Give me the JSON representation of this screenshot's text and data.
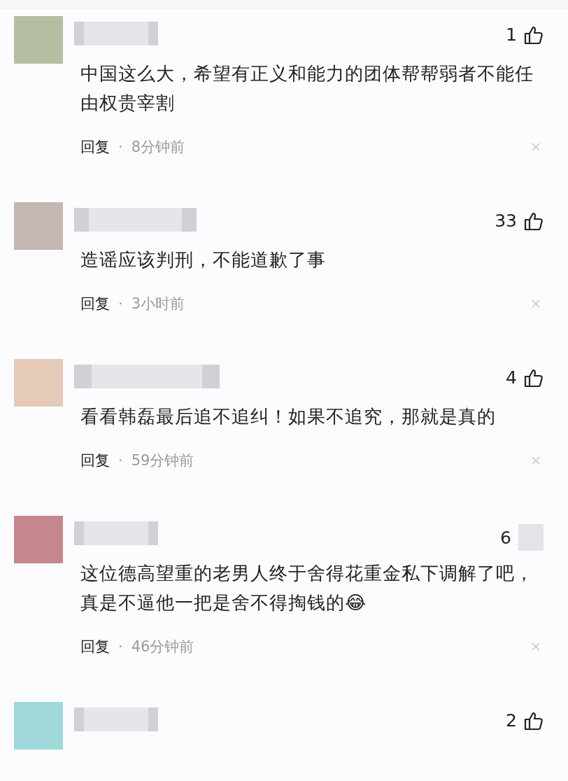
{
  "comments": [
    {
      "color": "#b4bea0",
      "likes": "1",
      "like_covered": false,
      "text": "中国这么大，希望有正义和能力的团体帮帮弱者不能任由权贵宰割",
      "reply": "回复",
      "separator": "·",
      "time": "8分钟前"
    },
    {
      "color": "#c4b6b0",
      "likes": "33",
      "like_covered": false,
      "text": "造谣应该判刑，不能道歉了事",
      "reply": "回复",
      "separator": "·",
      "time": "3小时前"
    },
    {
      "color": "#e6cab8",
      "likes": "4",
      "like_covered": false,
      "text": "看看韩磊最后追不追纠！如果不追究，那就是真的",
      "reply": "回复",
      "separator": "·",
      "time": "59分钟前"
    },
    {
      "color": "#c4888e",
      "likes": "6",
      "like_covered": true,
      "text": "这位德高望重的老男人终于舍得花重金私下调解了吧，真是不逼他一把是舍不得掏钱的😂",
      "reply": "回复",
      "separator": "·",
      "time": "46分钟前"
    },
    {
      "color": "#9ed8d8",
      "likes": "2",
      "like_covered": false
    }
  ]
}
